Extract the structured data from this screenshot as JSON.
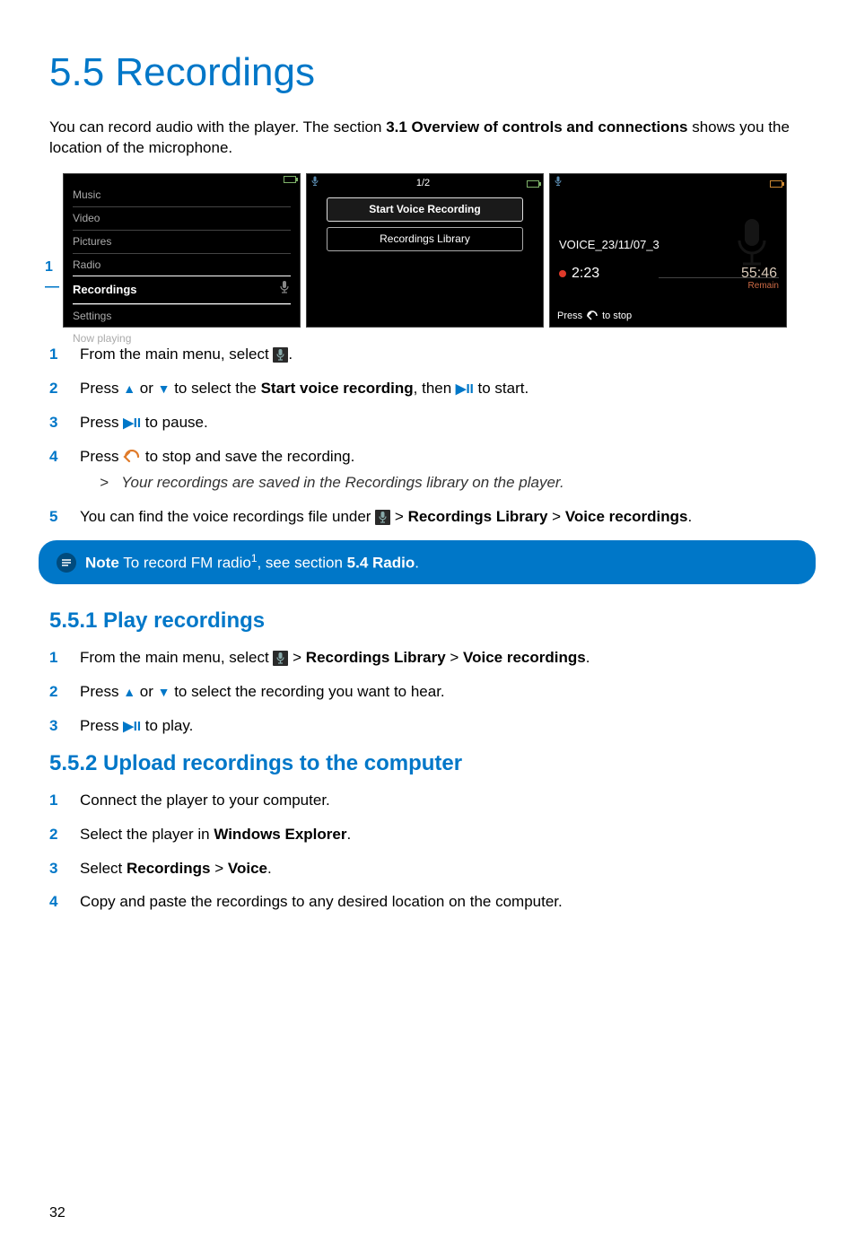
{
  "heading": "5.5  Recordings",
  "intro_pre": "You can record audio with the player. The section ",
  "intro_bold": "3.1 Overview of controls and connections",
  "intro_post": " shows you the location of the microphone.",
  "callout": "1",
  "screen1": {
    "items": [
      "Music",
      "Video",
      "Pictures",
      "Radio"
    ],
    "selected": "Recordings",
    "items2": [
      "Settings",
      "Now playing"
    ]
  },
  "screen2": {
    "page": "1/2",
    "opt1": "Start Voice Recording",
    "opt2": "Recordings Library"
  },
  "screen3": {
    "file": "VOICE_23/11/07_3",
    "remain_label": "Remain",
    "elapsed": "2:23",
    "remain": "55:46",
    "press": "Press",
    "tostop": "to stop"
  },
  "steps": {
    "s1a": "From the main menu, select ",
    "s1b": ".",
    "s2a": "Press ",
    "s2b": " or ",
    "s2c": " to select the ",
    "s2bold": "Start voice recording",
    "s2d": ", then ",
    "s2e": " to start.",
    "s3a": "Press ",
    "s3b": " to pause.",
    "s4a": "Press ",
    "s4b": " to stop and save the recording.",
    "s4sub": "Your recordings are saved in the Recordings library on the player.",
    "s5a": "You can find the voice recordings file under ",
    "s5b": " > ",
    "s5bold1": "Recordings Library",
    "s5c": " > ",
    "s5bold2": "Voice recordings",
    "s5d": "."
  },
  "note": {
    "label": "Note",
    "t1": " To record FM radio",
    "t2": ", see section ",
    "bold": "5.4 Radio",
    "t3": "."
  },
  "h551": "5.5.1 Play recordings",
  "play": {
    "s1a": "From the main menu, select ",
    "s1b": " > ",
    "s1bold1": "Recordings Library",
    "s1c": " > ",
    "s1bold2": "Voice recordings",
    "s1d": ".",
    "s2a": "Press ",
    "s2b": " or ",
    "s2c": " to select the recording you want to hear.",
    "s3a": "Press ",
    "s3b": " to play."
  },
  "h552": "5.5.2 Upload recordings to the computer",
  "upload": {
    "s1": "Connect the player to your computer.",
    "s2a": "Select the player in ",
    "s2bold": "Windows Explorer",
    "s2b": ".",
    "s3a": "Select ",
    "s3bold1": "Recordings",
    "s3b": " > ",
    "s3bold2": "Voice",
    "s3c": ".",
    "s4": "Copy and paste the recordings to any desired location on the computer."
  },
  "page": "32"
}
